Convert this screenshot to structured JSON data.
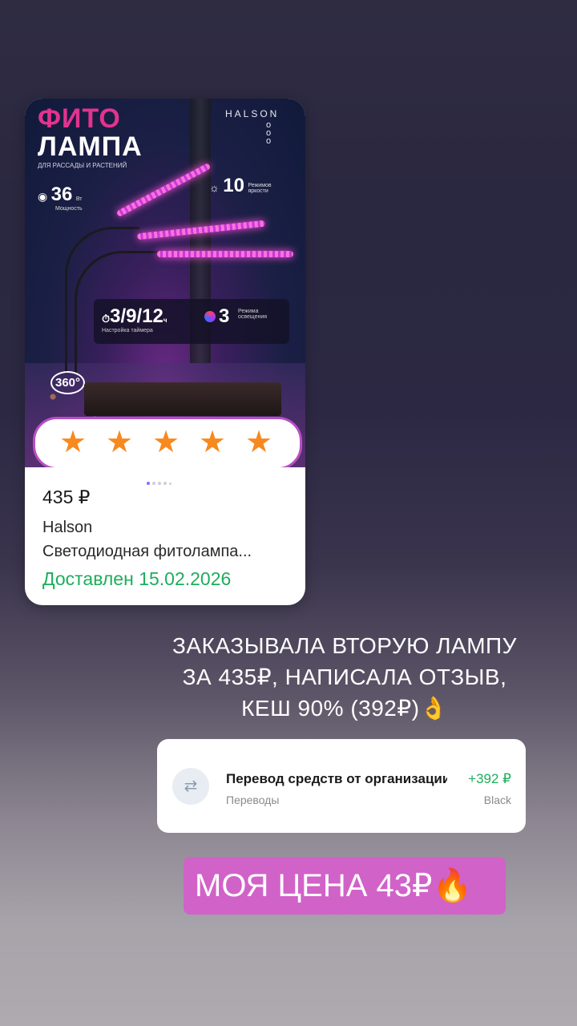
{
  "product": {
    "image": {
      "title_line1": "ФИТО",
      "title_line2": "ЛАМПА",
      "subtitle": "для рассады и растений",
      "brand": "HALSON",
      "power_value": "36",
      "power_unit": "Вт",
      "power_caption": "Мощность",
      "modes_value": "10",
      "modes_caption": "Режимов яркости",
      "timer_value": "3/9/12",
      "timer_unit": "ч",
      "timer_caption": "Настройка таймера",
      "light_modes_value": "3",
      "light_modes_caption": "Режима освещения",
      "rotation_badge": "360°",
      "stars": 5,
      "carousel_pages": 5,
      "carousel_active": 1
    },
    "price": "435 ₽",
    "seller": "Halson",
    "name": "Светодиодная фитолампа...",
    "status": "Доставлен 15.02.2026"
  },
  "story_text": "ЗАКАЗЫВАЛА ВТОРУЮ ЛАМПУ ЗА 435₽, НАПИСАЛА ОТЗЫВ, КЕШ 90% (392₽)👌",
  "transfer": {
    "title": "Перевод средств от организации",
    "category": "Переводы",
    "amount": "+392 ₽",
    "account": "Black",
    "icon": "transfer-arrows-icon"
  },
  "price_tag": "МОЯ ЦЕНА 43₽🔥",
  "colors": {
    "accent_pink": "#d162c8",
    "success_green": "#1cae5c",
    "star_orange": "#f7891e"
  }
}
